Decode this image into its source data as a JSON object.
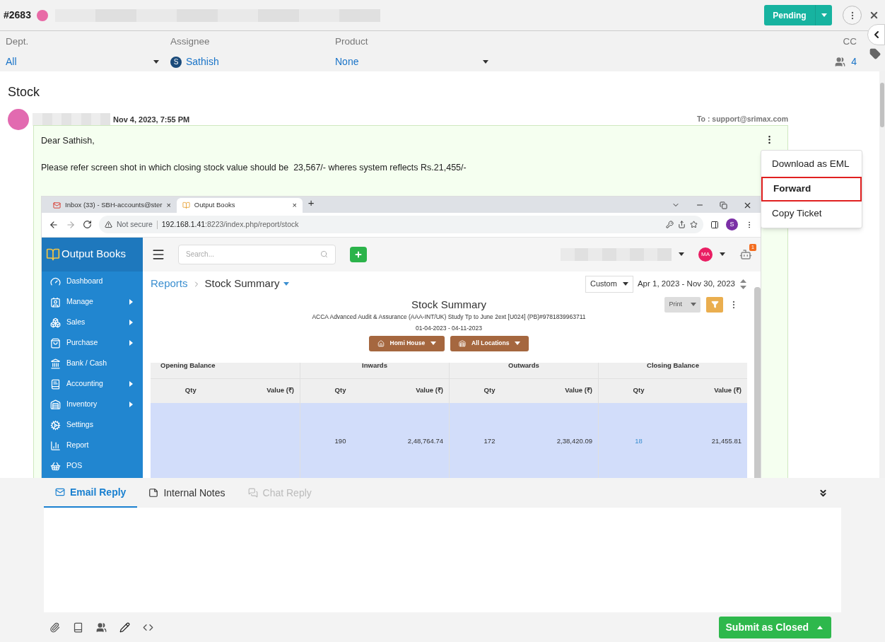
{
  "ticket": {
    "number": "#2683",
    "status": "Pending"
  },
  "fields": [
    {
      "label": "Dept.",
      "value": "All",
      "kind": "dropdown"
    },
    {
      "label": "Assignee",
      "value": "Sathish",
      "kind": "user",
      "initial": "S"
    },
    {
      "label": "Product",
      "value": "None",
      "kind": "dropdown"
    }
  ],
  "cc": {
    "label": "CC",
    "count": "4"
  },
  "subject": "Stock",
  "message": {
    "date": "Nov 4, 2023, 7:55 PM",
    "to": "To : support@srimax.com",
    "lines": [
      "Dear Sathish,",
      "Please refer screen shot in which closing stock value should be  23,567/- wheres system reflects Rs.21,455/-"
    ],
    "screenshot": {
      "browser_tabs": [
        {
          "label": "Inbox (33) - SBH-accounts@ster",
          "close": "×",
          "selected": false
        },
        {
          "label": "Output Books",
          "close": "×",
          "selected": true
        }
      ],
      "new_tab": "+",
      "url": {
        "warning": "Not secure",
        "host": "192.168.1.41",
        "path": ":8223/index.php/report/stock"
      },
      "profile": "S",
      "brand": "Output Books",
      "search_placeholder": "Search...",
      "user_initials": "MA",
      "notifications": "1",
      "sidebar": [
        {
          "label": "Dashboard",
          "submenu": false
        },
        {
          "label": "Manage",
          "submenu": true
        },
        {
          "label": "Sales",
          "submenu": true
        },
        {
          "label": "Purchase",
          "submenu": true
        },
        {
          "label": "Bank / Cash",
          "submenu": false
        },
        {
          "label": "Accounting",
          "submenu": true
        },
        {
          "label": "Inventory",
          "submenu": true
        },
        {
          "label": "Settings",
          "submenu": false
        },
        {
          "label": "Report",
          "submenu": false
        },
        {
          "label": "POS",
          "submenu": false
        }
      ],
      "breadcrumb": [
        "Reports",
        "Stock Summary"
      ],
      "range": {
        "preset": "Custom",
        "dates": "Apr 1, 2023 - Nov 30, 2023"
      },
      "report": {
        "title": "Stock Summary",
        "subtitle": "ACCA Advanced Audit & Assurance (AAA-INT/UK) Study Tp to June 2ext [U024] (PB)#9781839963711",
        "period": "01-04-2023 - 04-11-2023"
      },
      "filters": [
        "Homi House",
        "All Locations"
      ],
      "print": "Print",
      "table": [
        {
          "title": "Opening Balance",
          "columns": [
            "Qty",
            "Value (₹)"
          ]
        },
        {
          "title": "Inwards",
          "columns": [
            "Qty",
            "Value (₹)"
          ],
          "qty": "190",
          "value": "2,48,764.74"
        },
        {
          "title": "Outwards",
          "columns": [
            "Qty",
            "Value (₹)"
          ],
          "qty": "172",
          "value": "2,38,420.09"
        },
        {
          "title": "Closing Balance",
          "columns": [
            "Qty",
            "Value (₹)"
          ],
          "qty": "18",
          "value": "21,455.81",
          "linked": true
        }
      ]
    }
  },
  "menu": [
    {
      "label": "Download as EML",
      "selected": false
    },
    {
      "label": "Forward",
      "selected": true
    },
    {
      "label": "Copy Ticket",
      "selected": false
    }
  ],
  "reply": {
    "tabs": [
      {
        "label": "Email Reply",
        "selected": true,
        "disabled": false
      },
      {
        "label": "Internal Notes",
        "selected": false,
        "disabled": false
      },
      {
        "label": "Chat Reply",
        "selected": false,
        "disabled": true
      }
    ],
    "submit": "Submit as Closed"
  }
}
